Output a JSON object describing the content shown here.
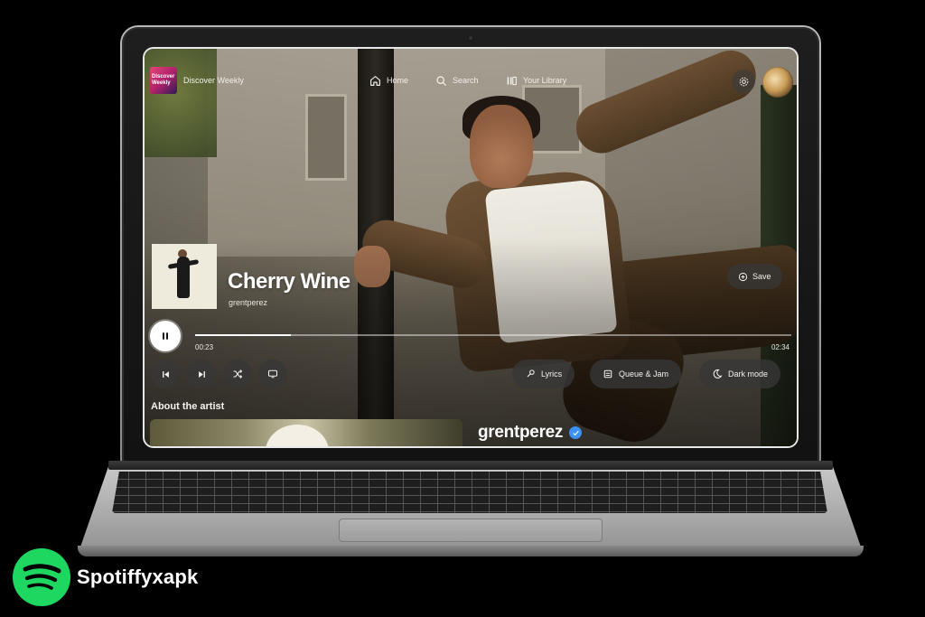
{
  "app": {
    "playlist_name": "Discover Weekly",
    "playlist_thumb_text": "Discover Weekly",
    "nav": {
      "home": "Home",
      "search": "Search",
      "library": "Your Library"
    }
  },
  "now_playing": {
    "title": "Cherry Wine",
    "artist": "grentperez",
    "current_time": "00:23",
    "total_time": "02:34",
    "progress_fraction": 0.16,
    "is_playing": true
  },
  "actions": {
    "save": "Save",
    "lyrics": "Lyrics",
    "queue_jam": "Queue & Jam",
    "dark_mode": "Dark mode"
  },
  "about": {
    "heading": "About the artist",
    "artist_name": "grentperez",
    "verified": true
  },
  "watermark": {
    "brand": "Spotiffyxapk"
  },
  "colors": {
    "brand_green": "#1ed760",
    "verified_blue": "#3d91f4"
  },
  "icons": [
    "home-icon",
    "search-icon",
    "library-icon",
    "settings-icon",
    "pause-icon",
    "previous-icon",
    "next-icon",
    "shuffle-icon",
    "device-icon",
    "lyrics-icon",
    "queue-icon",
    "dark-mode-icon",
    "save-icon",
    "verified-icon"
  ]
}
